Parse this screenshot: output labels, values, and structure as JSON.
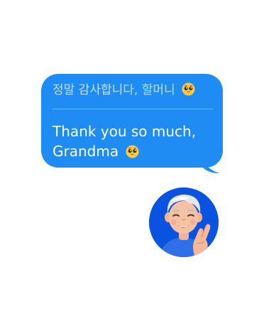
{
  "message": {
    "original_text": "정말 감사합니다, 할머니",
    "translated_line1": "Thank you so much,",
    "translated_line2": "Grandma",
    "emoji": "pleading-face-emoji"
  },
  "avatar": {
    "icon": "memoji-crossed-fingers-icon"
  },
  "colors": {
    "bubble": "#1e8cf2",
    "original_text": "#bfe0ff",
    "translated_text": "#ffffff",
    "avatar_bg": "#0a52e0",
    "page_bg": "#ffffff"
  }
}
